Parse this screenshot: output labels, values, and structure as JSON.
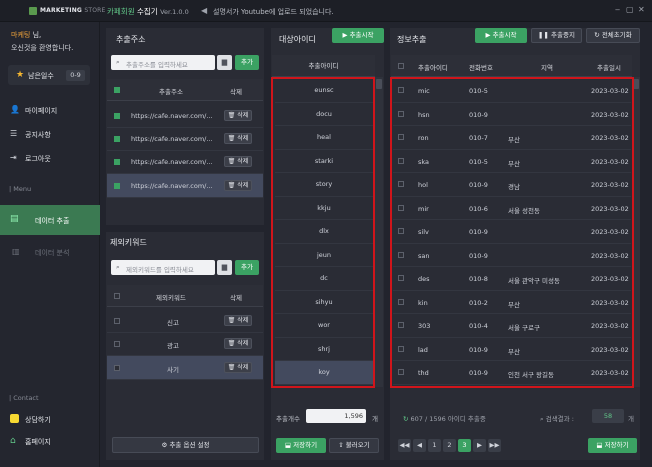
{
  "titlebar": {
    "brand": "MARKETING",
    "brand_store": "STORE",
    "app_accent": "카페회원",
    "app_title": "수집기",
    "version": "Ver.1.0.0",
    "notice": "설명서가 Youtube에 업로드 되었습니다."
  },
  "sidebar": {
    "user_name": "마케팅",
    "user_suffix": "님,",
    "welcome": "오신것을 환영합니다.",
    "count_label": "남은일수",
    "count_value": "0-9",
    "menu": [
      {
        "icon": "user-icon",
        "label": "마이페이지"
      },
      {
        "icon": "list-icon",
        "label": "공지사항"
      },
      {
        "icon": "logout-icon",
        "label": "로그아웃"
      }
    ],
    "menu_section": "| Menu",
    "active": {
      "label": "데이터 추출"
    },
    "dim": {
      "label": "데이터 분석"
    },
    "contact_section": "| Contact",
    "contact": [
      {
        "label": "상담하기"
      },
      {
        "label": "홈페이지"
      }
    ]
  },
  "extract": {
    "title": "추출주소",
    "placeholder": "추출주소를 입력하세요",
    "add_label": "추가",
    "col_addr": "추출주소",
    "col_del": "삭제",
    "rows": [
      {
        "addr": "https://cafe.naver.com/...",
        "del": "삭제"
      },
      {
        "addr": "https://cafe.naver.com/...",
        "del": "삭제"
      },
      {
        "addr": "https://cafe.naver.com/...",
        "del": "삭제"
      },
      {
        "addr": "https://cafe.naver.com/...",
        "del": "삭제"
      }
    ]
  },
  "exclude": {
    "title": "제외키워드",
    "placeholder": "제외키워드를 입력하세요",
    "add_label": "추가",
    "col_kw": "제외키워드",
    "col_del": "삭제",
    "rows": [
      {
        "kw": "신고",
        "del": "삭제"
      },
      {
        "kw": "광고",
        "del": "삭제"
      },
      {
        "kw": "사기",
        "del": "삭제"
      }
    ],
    "options_label": "추출 옵션 설정"
  },
  "target": {
    "title": "대상아이디",
    "start_label": "추출시작",
    "col_id": "추출아이디",
    "ids": [
      "eunsc",
      "docu",
      "heal",
      "starki",
      "story",
      "kkju",
      "dlx",
      "jeun",
      "dc",
      "sihyu",
      "wor",
      "shrj",
      "koy"
    ],
    "count_label": "추출개수",
    "count_value": "1,596",
    "count_unit": "개",
    "save_label": "저장하기",
    "load_label": "불러오기"
  },
  "info": {
    "title": "정보추출",
    "start_label": "추출시작",
    "stop_label": "추출중지",
    "reset_label": "전체초기화",
    "cols": [
      "추출아이디",
      "전화번호",
      "지역",
      "추출일시"
    ],
    "rows": [
      {
        "id": "mic",
        "phone": "010-5",
        "region": "",
        "date": "2023-03-02"
      },
      {
        "id": "hsn",
        "phone": "010-9",
        "region": "",
        "date": "2023-03-02"
      },
      {
        "id": "ron",
        "phone": "010-7",
        "region": "부산",
        "date": "2023-03-02"
      },
      {
        "id": "ska",
        "phone": "010-5",
        "region": "부산",
        "date": "2023-03-02"
      },
      {
        "id": "hol",
        "phone": "010-9",
        "region": "경남",
        "date": "2023-03-02"
      },
      {
        "id": "mir",
        "phone": "010-6",
        "region": "서울 성천동",
        "date": "2023-03-02"
      },
      {
        "id": "silv",
        "phone": "010-9",
        "region": "",
        "date": "2023-03-02"
      },
      {
        "id": "san",
        "phone": "010-9",
        "region": "",
        "date": "2023-03-02"
      },
      {
        "id": "des",
        "phone": "010-8",
        "region": "서울 관악구 미성동",
        "date": "2023-03-02"
      },
      {
        "id": "kin",
        "phone": "010-2",
        "region": "부산",
        "date": "2023-03-02"
      },
      {
        "id": "303",
        "phone": "010-4",
        "region": "서울 구로구",
        "date": "2023-03-02"
      },
      {
        "id": "lad",
        "phone": "010-9",
        "region": "부산",
        "date": "2023-03-02"
      },
      {
        "id": "thd",
        "phone": "010-9",
        "region": "인천 서구 왕길동",
        "date": "2023-03-02"
      }
    ],
    "progress": "607 / 1596 아이디 추출중",
    "result_label": "검색결과 :",
    "result_value": "58",
    "result_unit": "개",
    "pages": [
      "1",
      "2",
      "3"
    ],
    "active_page": "3",
    "save_label": "저장하기"
  },
  "colors": {
    "accent": "#3ba263",
    "highlight": "#d0151b",
    "warning": "#f5b731"
  }
}
